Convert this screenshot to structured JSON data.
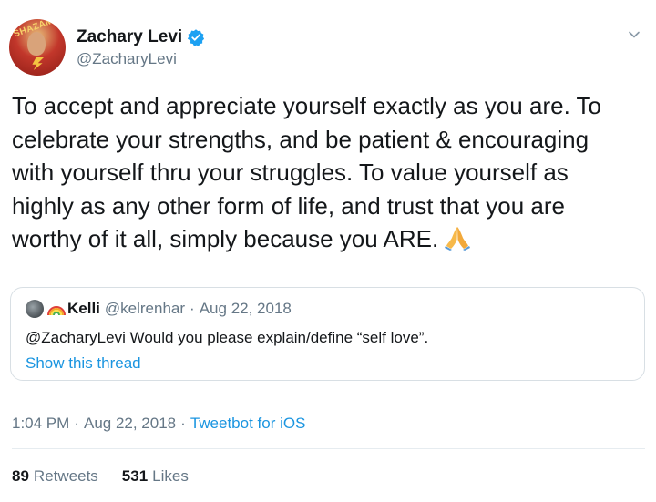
{
  "author": {
    "display_name": "Zachary Levi",
    "handle": "@ZacharyLevi",
    "verified": true,
    "avatar_banner_text": "SHAZAM"
  },
  "tweet": {
    "text": "To accept and appreciate yourself exactly as you are. To celebrate your strengths, and be patient & encouraging with yourself thru your struggles. To value yourself as highly as any other form of life, and trust that you are worthy of it all, simply because you ARE.",
    "emoji": "folded-hands"
  },
  "quoted_tweet": {
    "name": "Kelli",
    "handle": "@kelrenhar",
    "separator": "·",
    "date": "Aug 22, 2018",
    "text": "@ZacharyLevi Would you please explain/define “self love”.",
    "show_thread_label": "Show this thread"
  },
  "meta": {
    "time": "1:04 PM",
    "separator": "·",
    "date": "Aug 22, 2018",
    "source": "Tweetbot for iOS"
  },
  "stats": {
    "retweets_count": "89",
    "retweets_label": "Retweets",
    "likes_count": "531",
    "likes_label": "Likes"
  },
  "colors": {
    "text": "#14171a",
    "secondary": "#657786",
    "link": "#1b95e0",
    "verified": "#1da1f2",
    "border": "#d8dfe4"
  },
  "icons": {
    "verified": "verified-badge-icon",
    "menu": "chevron-down-icon",
    "emoji": "folded-hands-icon",
    "rainbow": "rainbow-icon"
  }
}
